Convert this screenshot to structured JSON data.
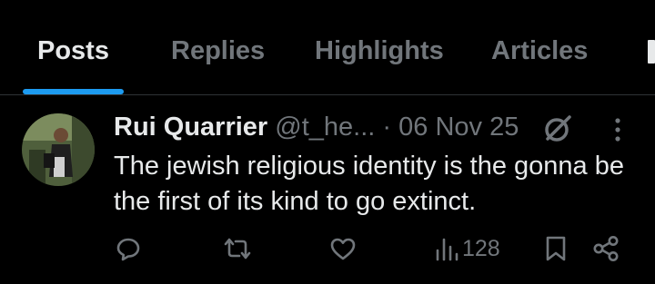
{
  "tabs": [
    {
      "label": "Posts",
      "active": true
    },
    {
      "label": "Replies",
      "active": false
    },
    {
      "label": "Highlights",
      "active": false
    },
    {
      "label": "Articles",
      "active": false
    }
  ],
  "post": {
    "author_name": "Rui Quarrier",
    "handle": "@t_he...",
    "separator": "·",
    "date": "06 Nov 25",
    "text": "The jewish religious identity is the gonna be the first of its kind to go extinct.",
    "views": "128"
  },
  "icons": {
    "badge": "no-entry-circle-icon",
    "more": "more-vertical-icon",
    "reply": "reply-icon",
    "repost": "repost-icon",
    "like": "heart-icon",
    "views": "views-icon",
    "bookmark": "bookmark-icon",
    "share": "share-icon"
  },
  "colors": {
    "background": "#000000",
    "text_primary": "#e7e9ea",
    "text_secondary": "#71767b",
    "accent": "#1d9bf0",
    "divider": "#2f3336"
  }
}
